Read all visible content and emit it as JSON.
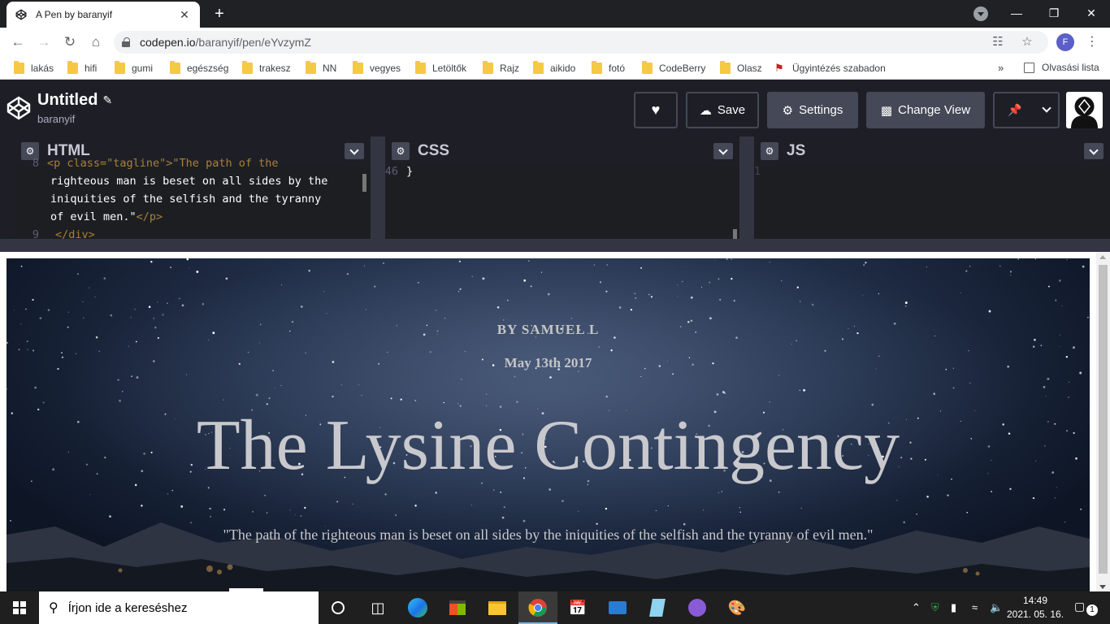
{
  "browser": {
    "tab_title": "A Pen by baranyif",
    "tab_close": "✕",
    "new_tab": "+",
    "window_controls": [
      "—",
      "❐",
      "✕"
    ],
    "url_host": "codepen.io",
    "url_path": "/baranyif/pen/eYvzymZ",
    "profile_initial": "F"
  },
  "bookmarks": {
    "items": [
      {
        "label": "lakás",
        "type": "folder"
      },
      {
        "label": "hifi",
        "type": "folder"
      },
      {
        "label": "gumi",
        "type": "folder"
      },
      {
        "label": "egészség",
        "type": "folder"
      },
      {
        "label": "trakesz",
        "type": "folder"
      },
      {
        "label": "NN",
        "type": "folder"
      },
      {
        "label": "vegyes",
        "type": "folder"
      },
      {
        "label": "Letöltők",
        "type": "folder"
      },
      {
        "label": "Rajz",
        "type": "folder"
      },
      {
        "label": "aikido",
        "type": "folder"
      },
      {
        "label": "fotó",
        "type": "folder"
      },
      {
        "label": "CodeBerry",
        "type": "folder"
      },
      {
        "label": "Olasz",
        "type": "folder"
      },
      {
        "label": "Ügyintézés szabadon",
        "type": "link"
      }
    ],
    "more": "»",
    "reading_list": "Olvasási lista"
  },
  "codepen": {
    "pen_title": "Untitled",
    "user": "baranyif",
    "save_label": "Save",
    "settings_label": "Settings",
    "change_view_label": "Change View"
  },
  "editors": {
    "html": {
      "name": "HTML",
      "lines": [
        {
          "ln": "8",
          "partial_top": "<p class=\"tagline\">\"The path of the"
        },
        {
          "ln": "",
          "text": "righteous man is beset on all sides by the"
        },
        {
          "ln": "",
          "text": "iniquities of the selfish and the tyranny"
        },
        {
          "ln": "",
          "text": "of evil men.\"",
          "close": "</p>"
        },
        {
          "ln": "9",
          "partial_bottom": "</div>"
        }
      ]
    },
    "css": {
      "name": "CSS",
      "line_no": "46",
      "line": "}"
    },
    "js": {
      "name": "JS",
      "line_no": "1",
      "line": ""
    }
  },
  "preview": {
    "byline": "BY SAMUEL L",
    "date": "May 13th 2017",
    "title": "The Lysine Contingency",
    "tagline": "\"The path of the righteous man is beset on all sides by the iniquities of the selfish and the tyranny of evil men.\""
  },
  "taskbar": {
    "search_placeholder": "Írjon ide a kereséshez",
    "time": "14:49",
    "date": "2021. 05. 16.",
    "notifications": "1"
  }
}
